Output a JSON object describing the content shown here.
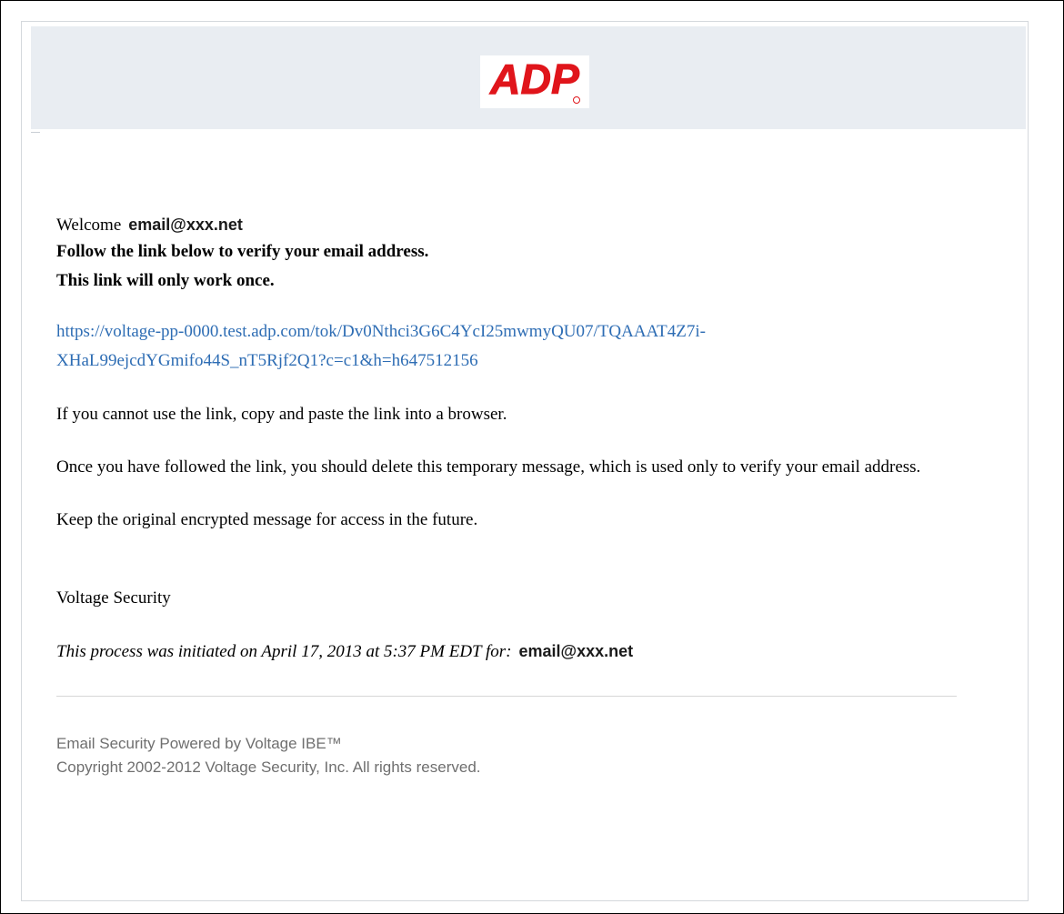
{
  "header": {
    "logo_text": "ADP",
    "logo_color": "#e0151b",
    "band_color": "#e9edf2"
  },
  "message": {
    "welcome_label": "Welcome",
    "recipient_email": "email@xxx.net",
    "instruction_line_1": "Follow the link below to verify your email address.",
    "instruction_line_2": "This link will only work once.",
    "verify_link": "https://voltage-pp-0000.test.adp.com/tok/Dv0Nthci3G6C4YcI25mwmyQU07/TQAAAT4Z7i-XHaL99ejcdYGmifo44S_nT5Rjf2Q1?c=c1&h=h647512156",
    "link_color": "#2e6db4",
    "copy_paste_note": "If you cannot use the link, copy and paste the link into a browser.",
    "delete_note": "Once you have followed the link, you should delete this temporary message, which is used only to verify your email address.",
    "keep_note": "Keep the original encrypted message for access in the future.",
    "signature": "Voltage Security",
    "initiated_text": "This process was initiated on April 17, 2013 at 5:37 PM EDT for:",
    "initiated_email": "email@xxx.net"
  },
  "footer": {
    "powered_by": "Email Security Powered by Voltage IBE™",
    "copyright": "Copyright 2002-2012 Voltage Security, Inc. All rights reserved."
  }
}
